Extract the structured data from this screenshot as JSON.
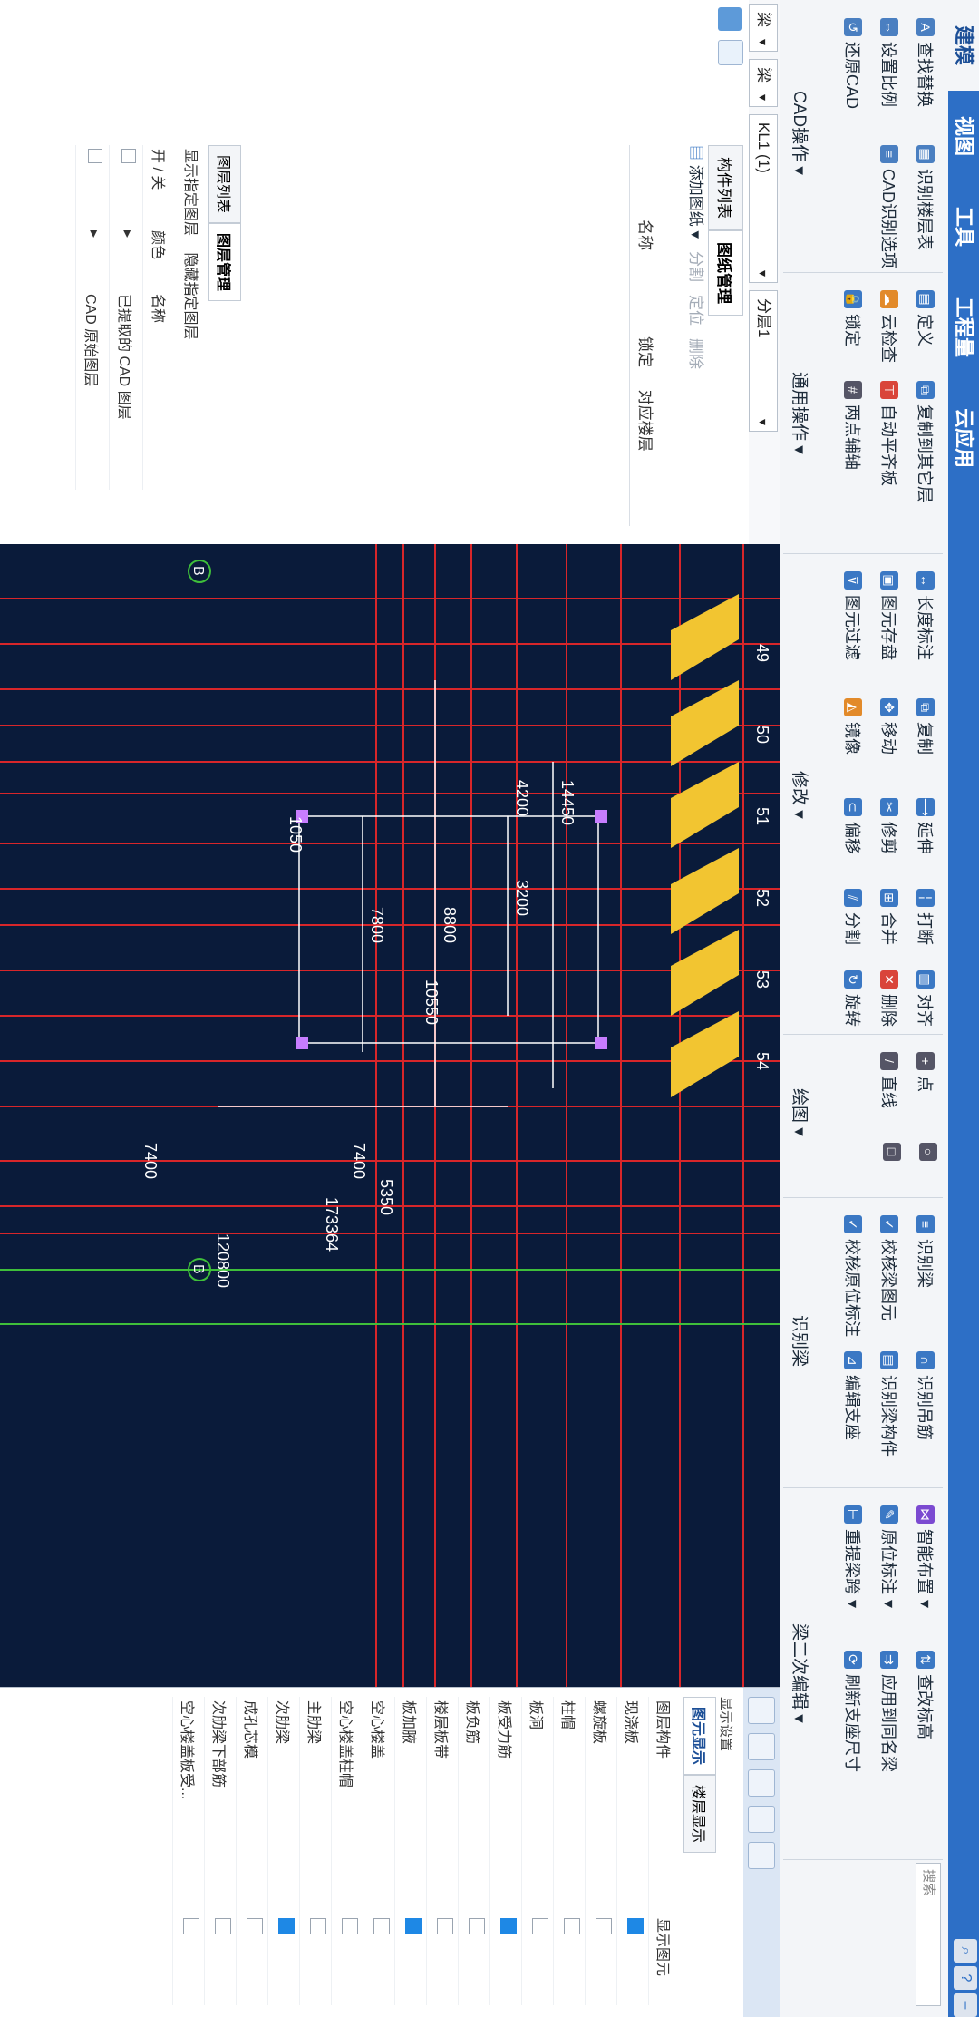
{
  "tabs": [
    "建模",
    "视图",
    "工具",
    "工程量",
    "云应用"
  ],
  "ribbon": {
    "cad_ops": [
      "查找替换",
      "识别楼层表",
      "设置比例",
      "CAD识别选项",
      "还原CAD"
    ],
    "cad_title": "CAD操作",
    "common": [
      "定义",
      "复制到其它层",
      "云检查",
      "自动平齐板",
      "锁定",
      "两点辅轴"
    ],
    "common_title": "通用操作",
    "modify": [
      "长度标注",
      "复制",
      "延伸",
      "打断",
      "对齐",
      "图元存盘",
      "移动",
      "修剪",
      "合并",
      "删除",
      "图元过滤",
      "镜像",
      "偏移",
      "分割",
      "旋转"
    ],
    "modify_title": "修改",
    "draw": [
      "点",
      "直线"
    ],
    "draw_title": "绘图",
    "recog": [
      "识别梁",
      "识别吊筋",
      "识别梁构件",
      "校核梁图元",
      "校核原位标注",
      "编辑支座"
    ],
    "recog_title": "识别梁",
    "beam2": [
      "智能布置",
      "查改标高",
      "原位标注",
      "应用到同名梁",
      "重提梁跨",
      "刷新支座尺寸"
    ],
    "beam2_title": "梁二次编辑",
    "search_placeholder": "搜索"
  },
  "selectors": [
    "梁",
    "梁",
    "KL1 (1)",
    "分层1"
  ],
  "left_panel": {
    "tabs": [
      "构件列表",
      "图纸管理"
    ],
    "tools": [
      "添加图纸",
      "分割",
      "定位",
      "删除"
    ],
    "col_name": "名称",
    "col_lock": "锁定",
    "col_layer": "对应楼层",
    "layer_tabs": [
      "图层列表",
      "图层管理"
    ],
    "layer_opts": [
      "显示指定图层",
      "隐藏指定图层"
    ],
    "cols": [
      "开 / 关",
      "颜色",
      "名称"
    ],
    "rows": [
      "已提取的 CAD 图层",
      "CAD 原始图层"
    ]
  },
  "canvas": {
    "axis_top": [
      "49",
      "50",
      "51",
      "52",
      "53",
      "54"
    ],
    "axis_b": "B",
    "dims": [
      "14450",
      "4200",
      "3200",
      "1050",
      "8800",
      "7800",
      "10550",
      "7400",
      "7400",
      "5350",
      "173364",
      "120800"
    ]
  },
  "right_panel": {
    "title": "显示设置",
    "tabs": [
      "图元显示",
      "楼层显示"
    ],
    "cols": [
      "图层构件",
      "显示图元"
    ],
    "items": [
      {
        "label": "现浇板",
        "on": true
      },
      {
        "label": "螺旋板",
        "on": false
      },
      {
        "label": "柱帽",
        "on": false
      },
      {
        "label": "板洞",
        "on": false
      },
      {
        "label": "板受力筋",
        "on": true
      },
      {
        "label": "板负筋",
        "on": false
      },
      {
        "label": "楼层板带",
        "on": false
      },
      {
        "label": "板加腋",
        "on": true
      },
      {
        "label": "空心楼盖",
        "on": false
      },
      {
        "label": "空心楼盖柱帽",
        "on": false
      },
      {
        "label": "主肋梁",
        "on": false
      },
      {
        "label": "次肋梁",
        "on": true
      },
      {
        "label": "成孔芯模",
        "on": false
      },
      {
        "label": "次肋梁下部筋",
        "on": false
      },
      {
        "label": "空心楼盖板受...",
        "on": false
      }
    ]
  }
}
